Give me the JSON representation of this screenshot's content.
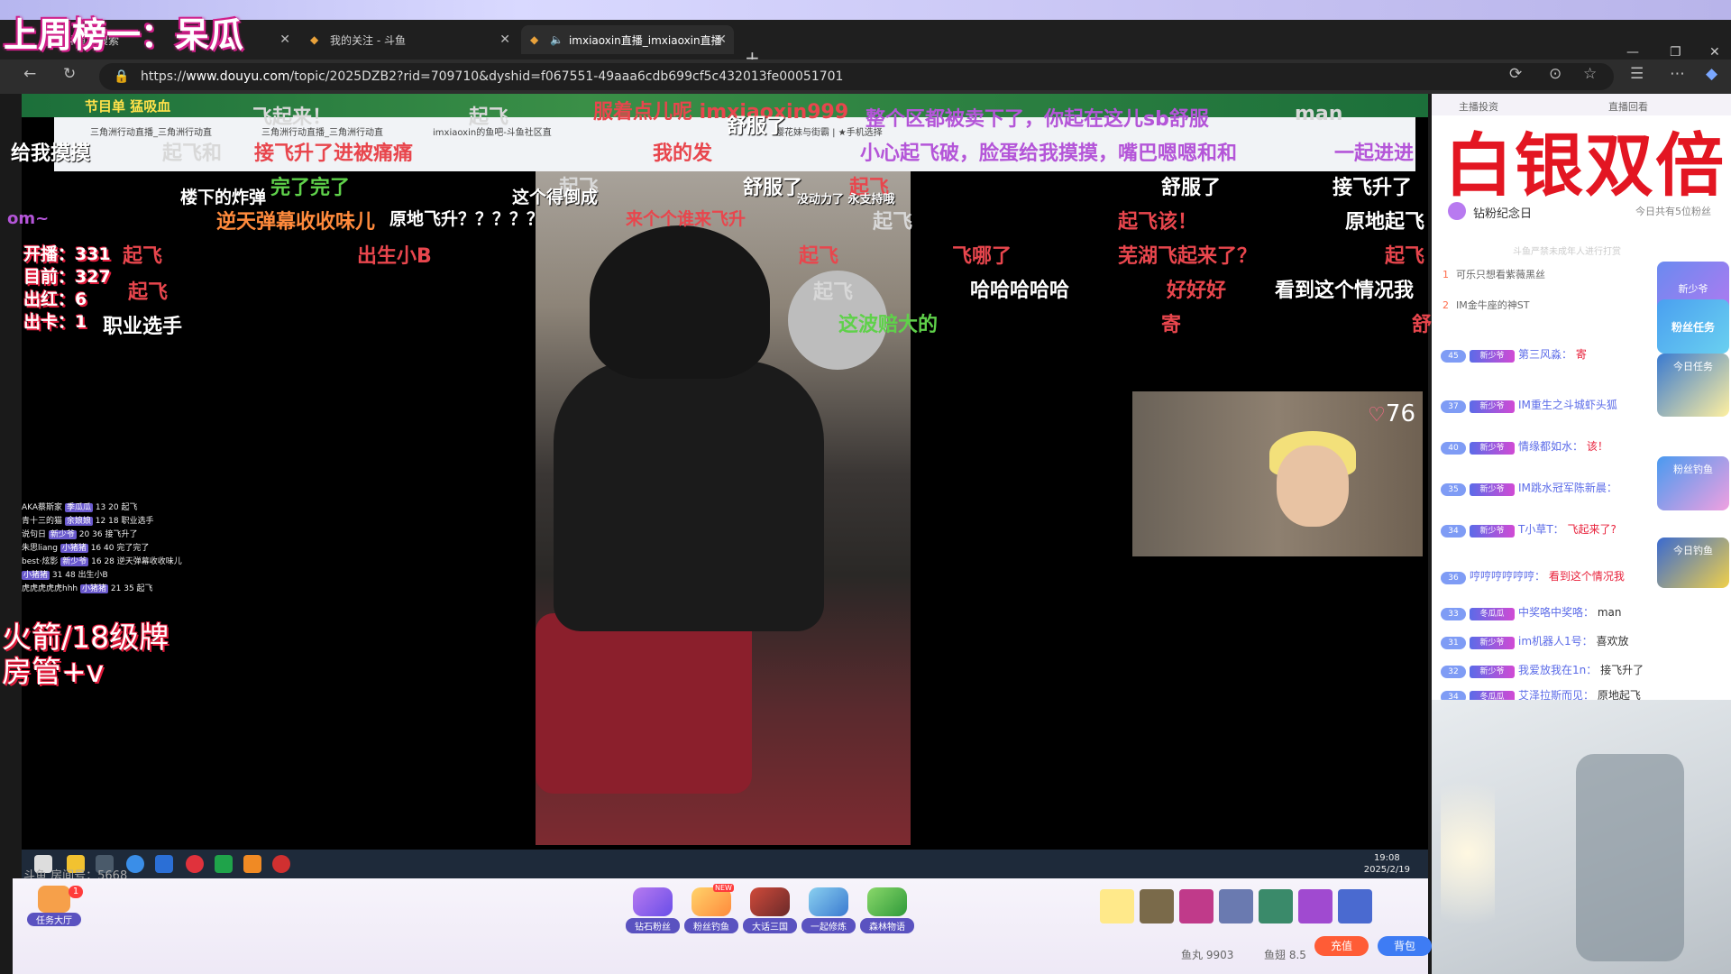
{
  "overlay": {
    "title": "上周榜一：呆瓜",
    "stats": [
      "开播：331",
      "目前：327",
      "出红：6",
      "出卡：1"
    ],
    "rocket_lines": [
      "火箭/18级牌",
      "房管+v"
    ],
    "silver_double": "白银双倍"
  },
  "browser": {
    "tabs": [
      {
        "label": "斗鱼 - 搜索"
      },
      {
        "label": "我的关注 - 斗鱼"
      },
      {
        "label": "imxiaoxin直播_imxiaoxin直播"
      }
    ],
    "url_prefix": "https://",
    "url_host": "www.douyu.com",
    "url_path": "/topic/2025DZB2?rid=709710&dyshid=f067551-49aaa6cdb699cf5c432013fe00051701"
  },
  "inner_window": {
    "tabs": [
      "三角洲行动直播_三角洲行动直",
      "三角洲行动直播_三角洲行动直",
      "imxiaoxin的鱼吧-斗鱼社区直",
      "樱花妹与街霸 | ★手机选择"
    ],
    "banner": "节目单 猛吸血"
  },
  "danmu": [
    {
      "text": "飞起来！",
      "color": "gray"
    },
    {
      "text": "起飞",
      "color": "gray"
    },
    {
      "text": "服着点儿呢 imxiaoxin999",
      "color": "red"
    },
    {
      "text": "舒服了",
      "color": "white"
    },
    {
      "text": "整个区都被卖下了，你起在这儿sb舒服",
      "color": "purple"
    },
    {
      "text": "man",
      "color": "gray"
    },
    {
      "text": "给我摸摸",
      "color": "white"
    },
    {
      "text": "起飞和",
      "color": "gray"
    },
    {
      "text": "接飞升了进被痛痛",
      "color": "red"
    },
    {
      "text": "我的发",
      "color": "red"
    },
    {
      "text": "小心起飞破，脸蛋给我摸摸，嘴巴嗯嗯和和",
      "color": "purple"
    },
    {
      "text": "一起进进",
      "color": "purple"
    },
    {
      "text": "完了完了",
      "color": "green"
    },
    {
      "text": "舒服了",
      "color": "white"
    },
    {
      "text": "起飞",
      "color": "gray"
    },
    {
      "text": "起飞",
      "color": "red"
    },
    {
      "text": "舒服了",
      "color": "white"
    },
    {
      "text": "接飞升了",
      "color": "white"
    },
    {
      "text": "楼下的炸弹",
      "color": "white"
    },
    {
      "text": "这个得倒成",
      "color": "white"
    },
    {
      "text": "没动力了 永支持哦",
      "color": "white"
    },
    {
      "text": "逆天弹幕收收味儿",
      "color": "orange"
    },
    {
      "text": "原地飞升？？？？？",
      "color": "white"
    },
    {
      "text": "来个个谁来飞升",
      "color": "red"
    },
    {
      "text": "起飞",
      "color": "gray"
    },
    {
      "text": "起飞该！",
      "color": "red"
    },
    {
      "text": "原地起飞",
      "color": "white"
    },
    {
      "text": "起飞",
      "color": "red"
    },
    {
      "text": "出生小B",
      "color": "red"
    },
    {
      "text": "起飞",
      "color": "red"
    },
    {
      "text": "飞哪了",
      "color": "red"
    },
    {
      "text": "芜湖飞起来了？",
      "color": "red"
    },
    {
      "text": "起飞",
      "color": "red"
    },
    {
      "text": "职业选手",
      "color": "white"
    },
    {
      "text": "起飞",
      "color": "gray"
    },
    {
      "text": "哈哈哈哈哈",
      "color": "white"
    },
    {
      "text": "好好好",
      "color": "red"
    },
    {
      "text": "看到这个情况我",
      "color": "white"
    },
    {
      "text": "这波赔大的",
      "color": "green"
    },
    {
      "text": "寄",
      "color": "red"
    },
    {
      "text": "舒",
      "color": "red"
    },
    {
      "text": "起飞",
      "color": "red"
    },
    {
      "text": "om~",
      "color": "purple"
    }
  ],
  "mini_chat": [
    {
      "user": "AKA蔡斯家",
      "badge": "季瓜瓜",
      "level": "13",
      "num": "20",
      "text": "起飞"
    },
    {
      "user": "青十三的猫",
      "badge": "余娘娘",
      "level": "12",
      "num": "18",
      "text": "职业选手"
    },
    {
      "user": "说句日",
      "badge": "新少爷",
      "level": "20",
      "num": "36",
      "text": "接飞升了"
    },
    {
      "user": "朱思liang",
      "badge": "小猪猪",
      "level": "16",
      "num": "40",
      "text": "完了完了"
    },
    {
      "user": "best·炫影",
      "badge": "新少爷",
      "level": "16",
      "num": "28",
      "text": "逆天弹幕收收味儿"
    },
    {
      "user": "",
      "badge": "小猪猪",
      "level": "31",
      "num": "48",
      "text": "出生小B"
    },
    {
      "user": "虎虎虎虎虎hhh",
      "badge": "小猪猪",
      "level": "21",
      "num": "35",
      "text": "起飞"
    }
  ],
  "webcam": {
    "likes": "76"
  },
  "taskbar": {
    "time": "19:08",
    "date": "2025/2/19",
    "room_label": "斗鱼 房间号：5668"
  },
  "toolbar": {
    "task_hall": "任务大厅",
    "task_badge": "1",
    "gifts": [
      {
        "label": "钻石粉丝"
      },
      {
        "label": "粉丝钓鱼",
        "tag": "NEW"
      },
      {
        "label": "大话三国"
      },
      {
        "label": "一起修炼"
      },
      {
        "label": "森林物语"
      }
    ],
    "fish_balls": "鱼丸 9903",
    "fish_wings": "鱼翅 8.5",
    "recharge": "充值",
    "backpack": "背包"
  },
  "right_panel": {
    "tabs": [
      "主播投资",
      "直播回看"
    ],
    "fan_day": "钻粉纪念日",
    "fan_day_count": "今日共有5位粉丝",
    "fan_day_hint": "斗鱼严禁未成年人进行打赏",
    "rank": [
      {
        "n": "1",
        "text": "可乐只想看紫薇黑丝"
      },
      {
        "n": "2",
        "text": "IM金牛座的神ST"
      }
    ],
    "messages": [
      {
        "level": "45",
        "badge": "新少爷",
        "user": "第三风淼：",
        "text": "寄",
        "red": true
      },
      {
        "level": "37",
        "badge": "新少爷",
        "user": "IM重生之斗城虾头狐",
        "text": "",
        "red": false
      },
      {
        "level": "40",
        "badge": "新少爷",
        "user": "情缘都如水：",
        "text": "该！",
        "red": true
      },
      {
        "level": "35",
        "badge": "新少爷",
        "user": "IM跳水冠军陈新晨：",
        "text": "",
        "red": false
      },
      {
        "level": "34",
        "badge": "新少爷",
        "user": "T小草T：",
        "text": "飞起来了?",
        "red": true
      },
      {
        "level": "36",
        "badge": "",
        "user": "哼哼哼哼哼哼：",
        "text": "看到这个情况我",
        "red": true
      },
      {
        "level": "33",
        "badge": "冬瓜瓜",
        "user": "中奖咯中奖咯：",
        "text": "man",
        "red": false
      },
      {
        "level": "31",
        "badge": "新少爷",
        "user": "im机器人1号：",
        "text": "喜欢放",
        "red": false
      },
      {
        "level": "32",
        "badge": "新少爷",
        "user": "我爱放我在1n：",
        "text": "接飞升了",
        "red": false
      },
      {
        "level": "34",
        "badge": "冬瓜瓜",
        "user": "艾泽拉斯而见：",
        "text": "原地起飞",
        "red": false
      }
    ],
    "side_acts": [
      "新少爷",
      "粉丝任务",
      "今日任务",
      "粉丝钓鱼",
      "今日钓鱼"
    ]
  }
}
